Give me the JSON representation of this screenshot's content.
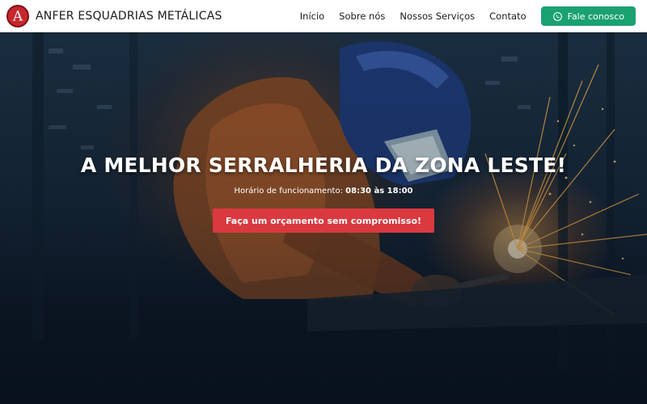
{
  "header": {
    "brand": "ANFER ESQUADRIAS METÁLICAS",
    "logo_letter": "A",
    "nav": [
      {
        "label": "Início"
      },
      {
        "label": "Sobre nós"
      },
      {
        "label": "Nossos Serviços"
      },
      {
        "label": "Contato"
      }
    ],
    "contact_button": {
      "label": "Fale conosco",
      "icon": "whatsapp-icon",
      "color": "#1aa172"
    }
  },
  "hero": {
    "title": "A MELHOR SERRALHERIA DA ZONA LESTE!",
    "hours_label": "Horário de funcionamento:",
    "hours_value": "08:30 às 18:00",
    "cta_label": "Faça um orçamento sem compromisso!",
    "cta_color": "#d9393f",
    "background": "welder-with-sparks-photo"
  },
  "colors": {
    "brand_red": "#c8272d",
    "whatsapp_green": "#1aa172"
  }
}
